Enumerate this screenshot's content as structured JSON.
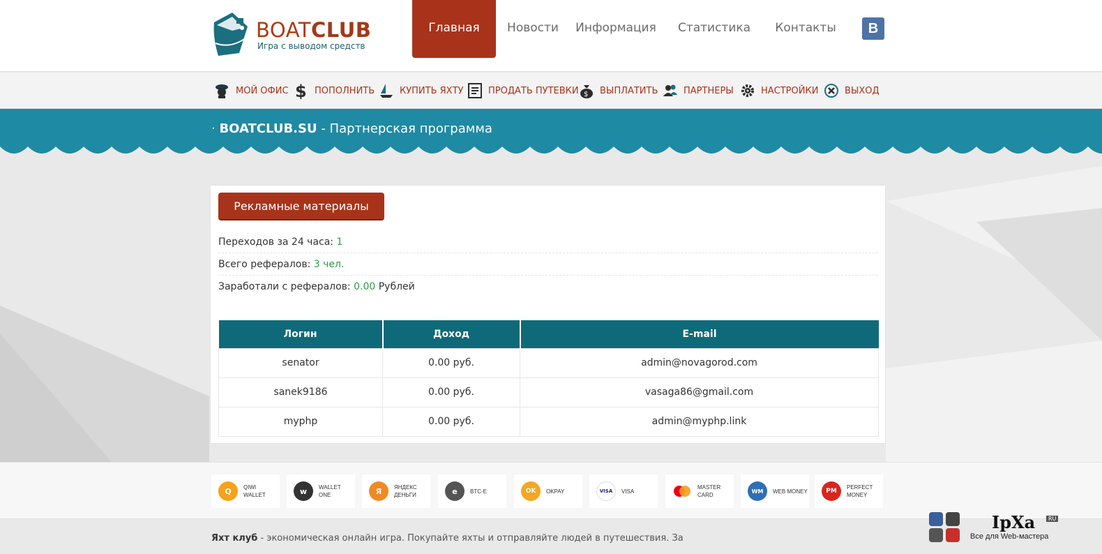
{
  "logo": {
    "brand_left": "BOAT",
    "brand_right": "CLUB",
    "tagline": "Игра с выводом средств"
  },
  "topnav": [
    "Главная",
    "Новости",
    "Информация",
    "Статистика",
    "Контакты"
  ],
  "vk_label": "В",
  "subnav": [
    "МОЙ ОФИС",
    "ПОПОЛНИТЬ",
    "КУПИТЬ ЯХТУ",
    "ПРОДАТЬ ПУТЕВКИ",
    "ВЫПЛАТИТЬ",
    "ПАРТНЕРЫ",
    "НАСТРОЙКИ",
    "ВЫХОД"
  ],
  "band": {
    "prefix": "· ",
    "site": "BOATCLUB.SU",
    "rest": " - Партнерская программа"
  },
  "promo_button": "Рекламные материалы",
  "stats": [
    {
      "label": "Переходов за 24 часа: ",
      "value": "1",
      "suffix": ""
    },
    {
      "label": "Всего рефералов: ",
      "value": "3 чел.",
      "suffix": ""
    },
    {
      "label": "Заработали с рефералов: ",
      "value": "0.00",
      "suffix": " Рублей"
    }
  ],
  "table": {
    "headers": [
      "Логин",
      "Доход",
      "E-mail"
    ],
    "rows": [
      [
        "senator",
        "0.00 руб.",
        "admin@novagorod.com"
      ],
      [
        "sanek9186",
        "0.00 руб.",
        "vasaga86@gmail.com"
      ],
      [
        "myphp",
        "0.00 руб.",
        "admin@myphp.link"
      ]
    ]
  },
  "payments": [
    {
      "l1": "QIWI",
      "l2": "WALLET",
      "color": "#f6a21a",
      "glyph": "Q"
    },
    {
      "l1": "WALLET",
      "l2": "ONE",
      "color": "#333333",
      "glyph": "w"
    },
    {
      "l1": "ЯНДЕКС",
      "l2": "ДЕНЬГИ",
      "color": "#f08a24",
      "glyph": "Я"
    },
    {
      "l1": "BTC-E",
      "l2": "",
      "color": "#555555",
      "glyph": "e"
    },
    {
      "l1": "OKPAY",
      "l2": "",
      "color": "#f5a623",
      "glyph": "OK"
    },
    {
      "l1": "VISA",
      "l2": "",
      "color": "#ffffff",
      "glyph": "VISA"
    },
    {
      "l1": "MASTER",
      "l2": "CARD",
      "color": "#ffffff",
      "glyph": "MC"
    },
    {
      "l1": "WEB MONEY",
      "l2": "",
      "color": "#2f6fb5",
      "glyph": "WM"
    },
    {
      "l1": "PERFECT",
      "l2": "MONEY",
      "color": "#d9261c",
      "glyph": "PM"
    }
  ],
  "footer": {
    "bold": "Яхт клуб",
    "text": " - экономическая онлайн игра. Покупайте яхты и отправляйте людей в путешествия. За"
  },
  "watermark": {
    "name": "IpXa",
    "ru": "RU",
    "sub": "Все для Web-мастера"
  },
  "colors": {
    "accent": "#a8331a",
    "teal": "#1f8aa3",
    "table_head": "#0e6a79",
    "value_green": "#2e9b44"
  }
}
